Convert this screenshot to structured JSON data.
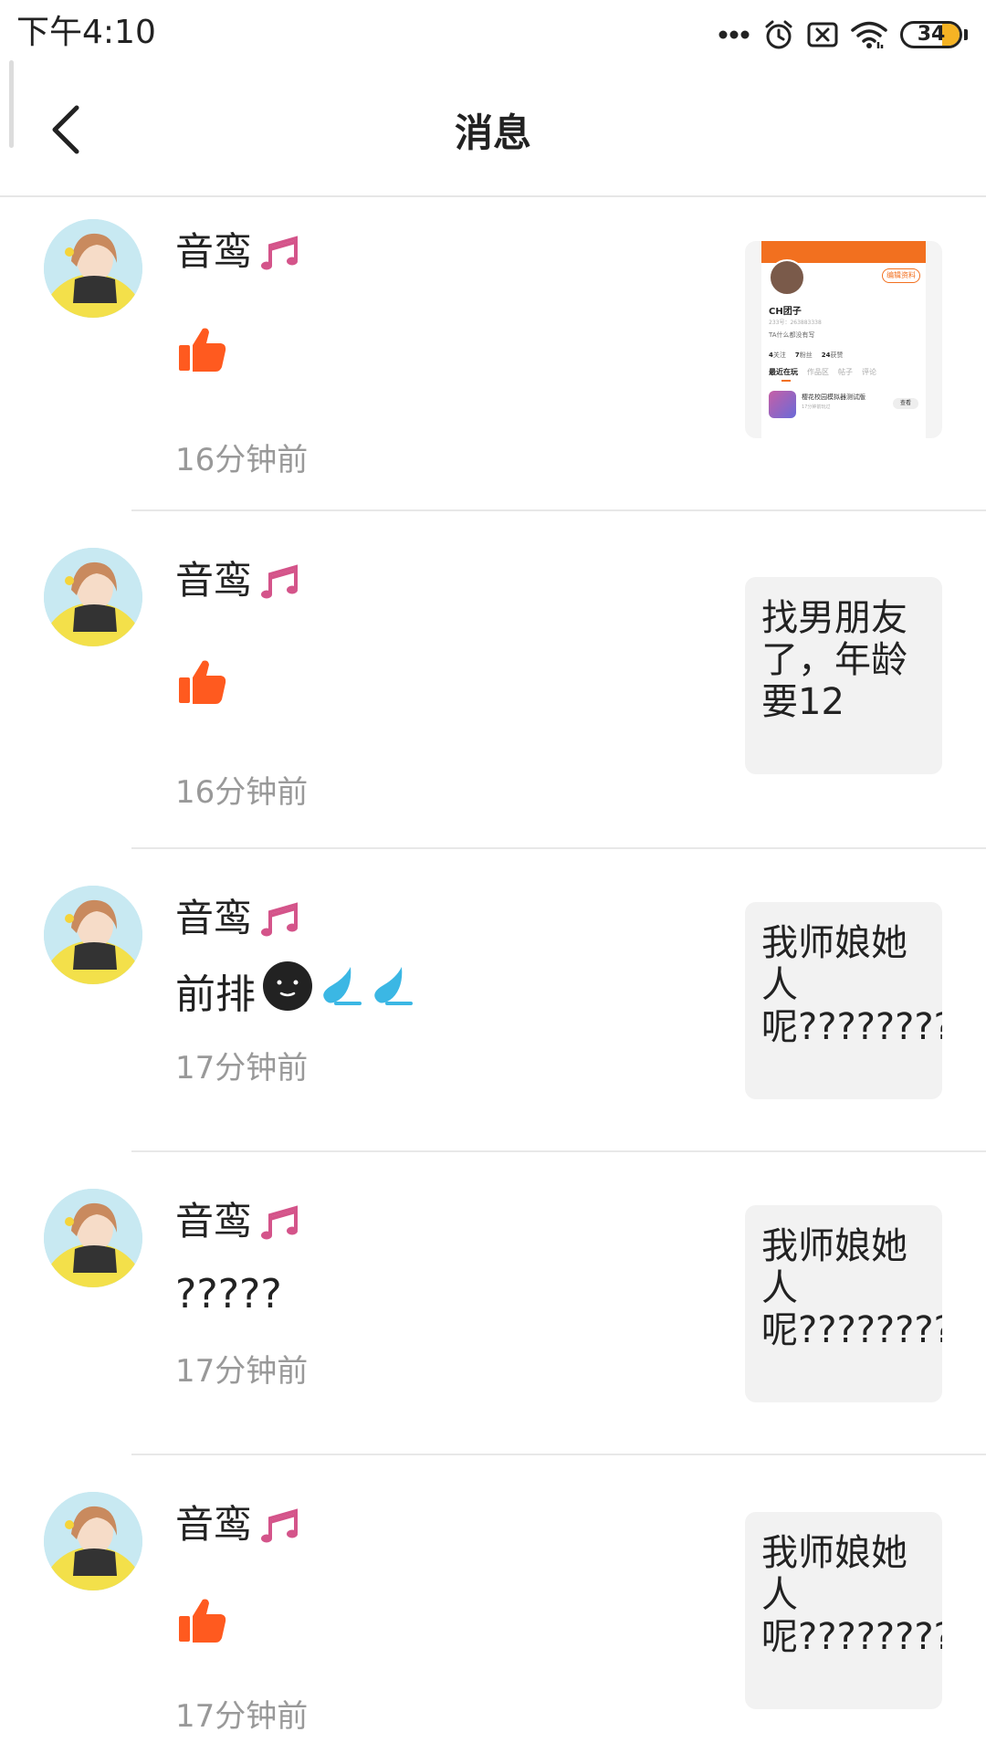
{
  "status_bar": {
    "time": "下午4:10",
    "battery": "34",
    "icons": [
      "more-dots-icon",
      "alarm-icon",
      "no-sim-icon",
      "wifi-icon",
      "battery-icon"
    ]
  },
  "header": {
    "title": "消息",
    "back_icon": "chevron-left-icon"
  },
  "colors": {
    "accent": "#ff5a1f",
    "time_text": "#999999",
    "card_bg": "#f2f2f2",
    "music_note": "#d4548a"
  },
  "messages": [
    {
      "username": "音鸾",
      "content_type": "like",
      "content_text": "",
      "time": "16分钟前",
      "preview_type": "profile-screenshot",
      "preview_text": "",
      "profile_preview": {
        "edit_label": "编辑资料",
        "name": "CH团子",
        "id_line": "233号：263883338",
        "bio": "TA什么都没有写",
        "stats": [
          {
            "num": "4",
            "label": "关注"
          },
          {
            "num": "7",
            "label": "粉丝"
          },
          {
            "num": "24",
            "label": "获赞"
          }
        ],
        "tabs": [
          "最近在玩",
          "作品区",
          "帖子",
          "评论"
        ],
        "game_name": "樱花校园模拟器测试版",
        "game_sub": "17分钟前玩过",
        "game_button": "查看"
      }
    },
    {
      "username": "音鸾",
      "content_type": "like",
      "content_text": "",
      "time": "16分钟前",
      "preview_type": "text",
      "preview_text": "找男朋友了，年龄要12"
    },
    {
      "username": "音鸾",
      "content_type": "text",
      "content_text": "前排",
      "content_emojis": [
        "dark-smiley-emoji",
        "sweat-drop-emoji",
        "sweat-drop-emoji"
      ],
      "time": "17分钟前",
      "preview_type": "text",
      "preview_text": "我师娘她人呢????????"
    },
    {
      "username": "音鸾",
      "content_type": "text",
      "content_text": "?????",
      "time": "17分钟前",
      "preview_type": "text",
      "preview_text": "我师娘她人呢????????"
    },
    {
      "username": "音鸾",
      "content_type": "like",
      "content_text": "",
      "time": "17分钟前",
      "preview_type": "text",
      "preview_text": "我师娘她人呢????????"
    }
  ]
}
